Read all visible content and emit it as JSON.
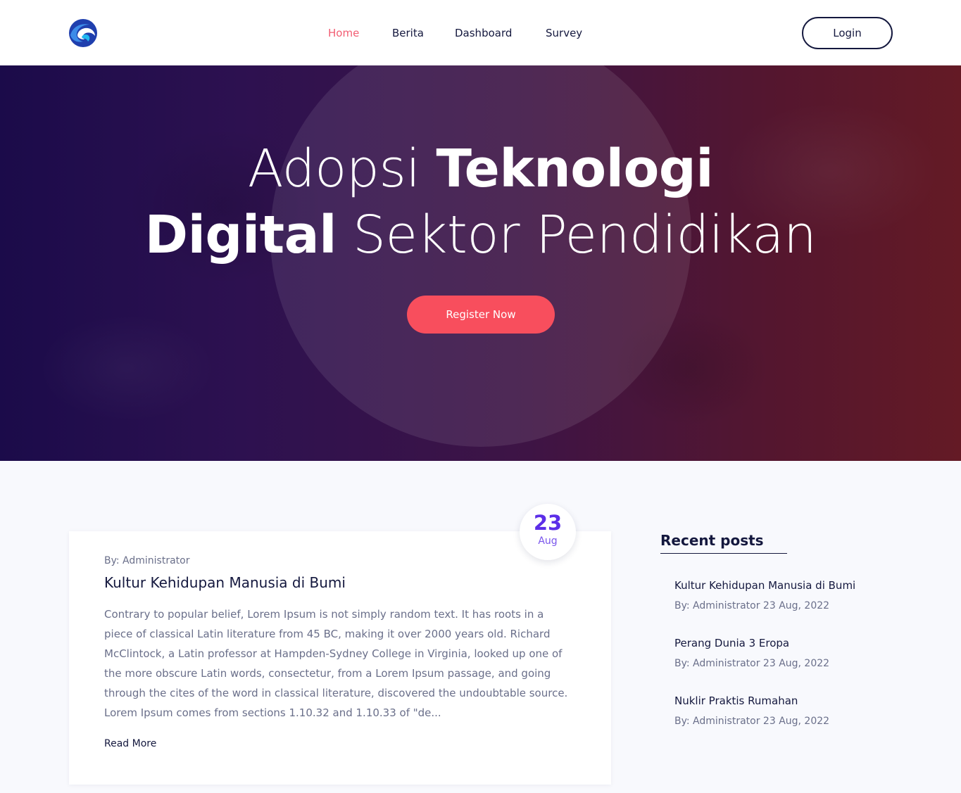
{
  "header": {
    "logo_icon": "globe-wave-logo-icon",
    "nav": [
      {
        "label": "Home",
        "active": true
      },
      {
        "label": "Berita",
        "active": false
      },
      {
        "label": "Dashboard",
        "active": false
      },
      {
        "label": "Survey",
        "active": false
      }
    ],
    "login_label": "Login"
  },
  "hero": {
    "title_line1_light": "Adopsi",
    "title_line1_bold": "Teknologi",
    "title_line2_bold": "Digital",
    "title_line2_light": "Sektor Pendidikan",
    "cta_label": "Register Now"
  },
  "post": {
    "date_day": "23",
    "date_month": "Aug",
    "author": "By: Administrator",
    "title": "Kultur Kehidupan Manusia di Bumi",
    "excerpt": "Contrary to popular belief, Lorem Ipsum is not simply random text. It has roots in a piece of classical Latin literature from 45 BC, making it over 2000 years old. Richard McClintock, a Latin professor at Hampden-Sydney College in Virginia, looked up one of the more obscure Latin words, consectetur, from a Lorem Ipsum passage, and going through the cites of the word in classical literature, discovered the undoubtable source. Lorem Ipsum comes from sections 1.10.32 and 1.10.33 of \"de...",
    "read_more": "Read More"
  },
  "sidebar": {
    "title": "Recent posts",
    "items": [
      {
        "title": "Kultur Kehidupan Manusia di Bumi",
        "meta": "By: Administrator 23 Aug, 2022"
      },
      {
        "title": "Perang Dunia 3 Eropa",
        "meta": "By: Administrator 23 Aug, 2022"
      },
      {
        "title": "Nuklir Praktis Rumahan",
        "meta": "By: Administrator 23 Aug, 2022"
      }
    ]
  },
  "colors": {
    "accent": "#f84e5d",
    "nav_active": "#f25c72",
    "date_accent": "#5c2ee8",
    "text_dark": "#14183e",
    "text_muted": "#6a6f8a"
  }
}
